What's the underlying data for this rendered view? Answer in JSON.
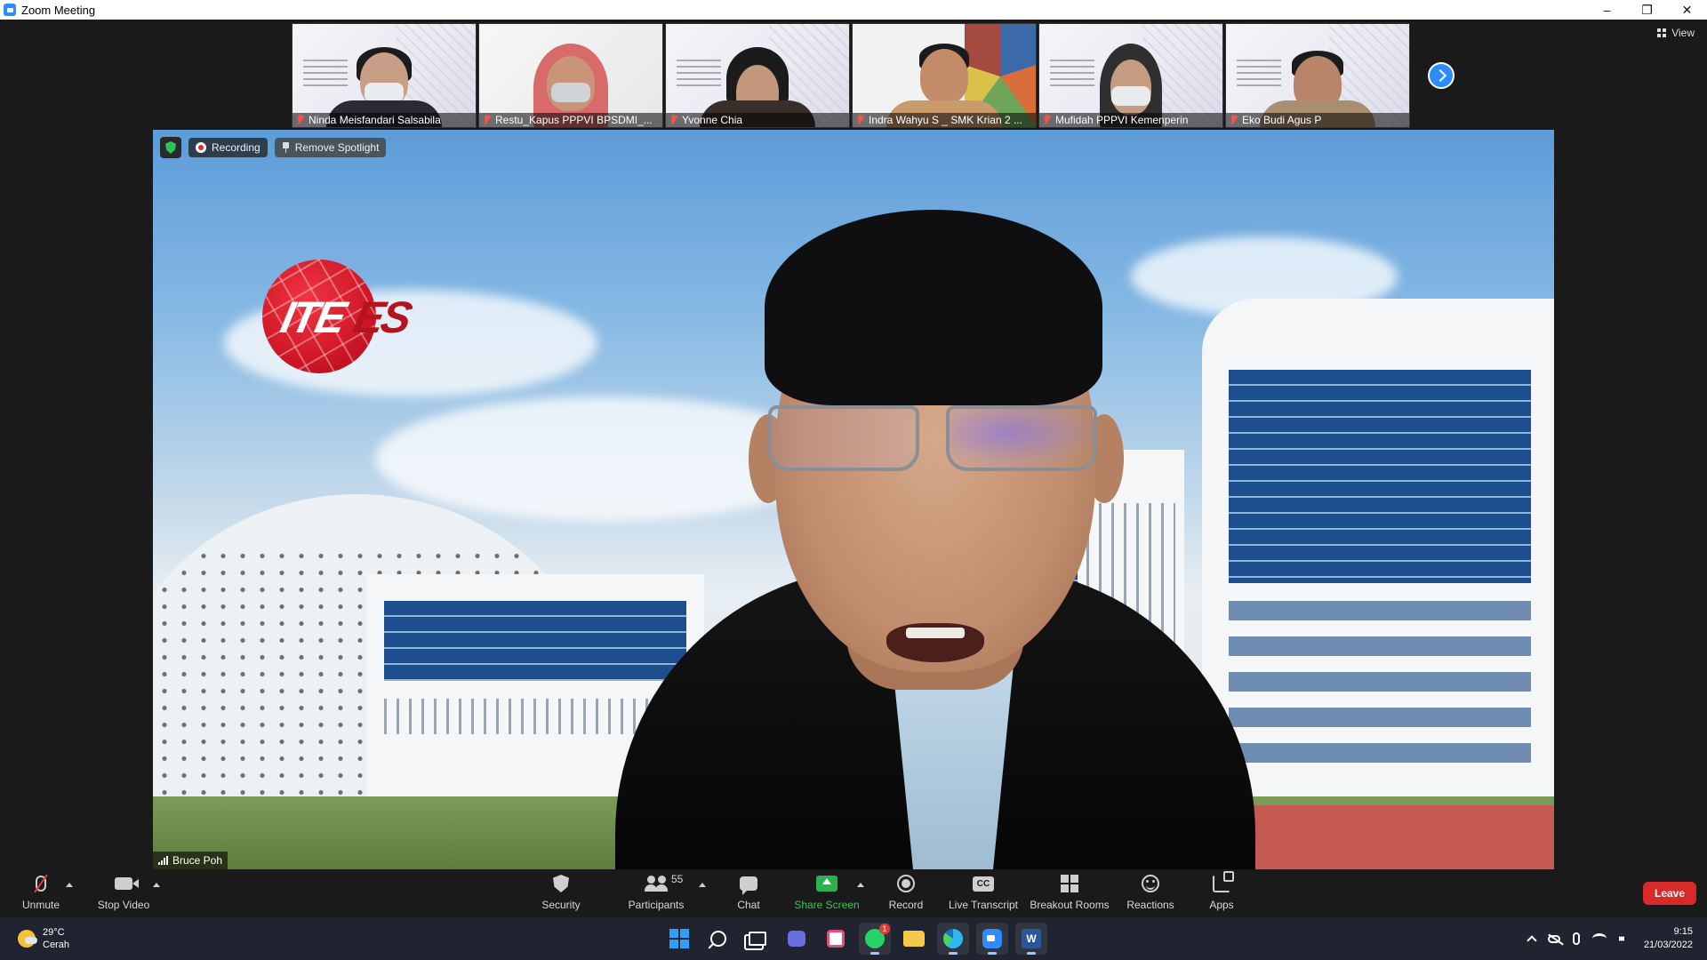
{
  "window": {
    "title": "Zoom Meeting"
  },
  "view_button": {
    "label": "View"
  },
  "participants_strip": [
    {
      "name": "Ninda Meisfandari Salsabila",
      "muted": true,
      "style": "slide-masked"
    },
    {
      "name": "Restu_Kapus PPPVI BPSDMI_...",
      "muted": true,
      "style": "hijab-red"
    },
    {
      "name": "Yvonne Chia",
      "muted": true,
      "style": "slide-hair"
    },
    {
      "name": "Indra Wahyu S _ SMK Krian 2 ...",
      "muted": true,
      "style": "collage"
    },
    {
      "name": "Mufidah PPPVI Kemenperin",
      "muted": true,
      "style": "slide-masked-hijab"
    },
    {
      "name": "Eko Budi Agus P",
      "muted": true,
      "style": "slide-man"
    }
  ],
  "main_video": {
    "speaker_name": "Bruce Poh",
    "recording_label": "Recording",
    "remove_spotlight_label": "Remove Spotlight",
    "logo": {
      "part1": "ITE",
      "part2": "ES"
    }
  },
  "toolbar": {
    "unmute": "Unmute",
    "stop_video": "Stop Video",
    "security": "Security",
    "participants": "Participants",
    "participants_count": "55",
    "chat": "Chat",
    "share_screen": "Share Screen",
    "record": "Record",
    "live_transcript": "Live Transcript",
    "cc": "CC",
    "breakout_rooms": "Breakout Rooms",
    "reactions": "Reactions",
    "apps": "Apps",
    "leave": "Leave"
  },
  "taskbar": {
    "weather_temp": "29°C",
    "weather_desc": "Cerah",
    "whatsapp_badge": "1",
    "word_letter": "W",
    "time": "9:15",
    "date": "21/03/2022"
  },
  "colors": {
    "zoom_blue": "#2d8cff",
    "share_green": "#2ab152",
    "leave_red": "#d92a2a",
    "taskbar_bg": "#1f2430"
  }
}
